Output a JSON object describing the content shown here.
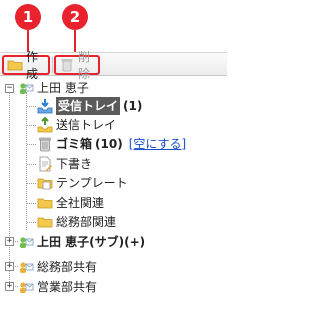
{
  "callouts": [
    "1",
    "2"
  ],
  "toolbar": {
    "create_label": "作成",
    "delete_label": "削除"
  },
  "tree": {
    "root_user": "上田 恵子",
    "inbox": {
      "label": "受信トレイ",
      "count": "(1)"
    },
    "sent": "送信トレイ",
    "trash": {
      "label": "ゴミ箱",
      "count": "(10)",
      "empty_link": "[空にする]"
    },
    "drafts": "下書き",
    "templates": "テンプレート",
    "folders": [
      "全社関連",
      "総務部関連"
    ],
    "sub_user": "上田 恵子(サブ)(+)",
    "shared": [
      "総務部共有",
      "営業部共有"
    ]
  },
  "colors": {
    "callout": "#e8232d",
    "selection": "#5b5b5b",
    "link": "#1a4ec8",
    "folder": "#f2c94c"
  }
}
